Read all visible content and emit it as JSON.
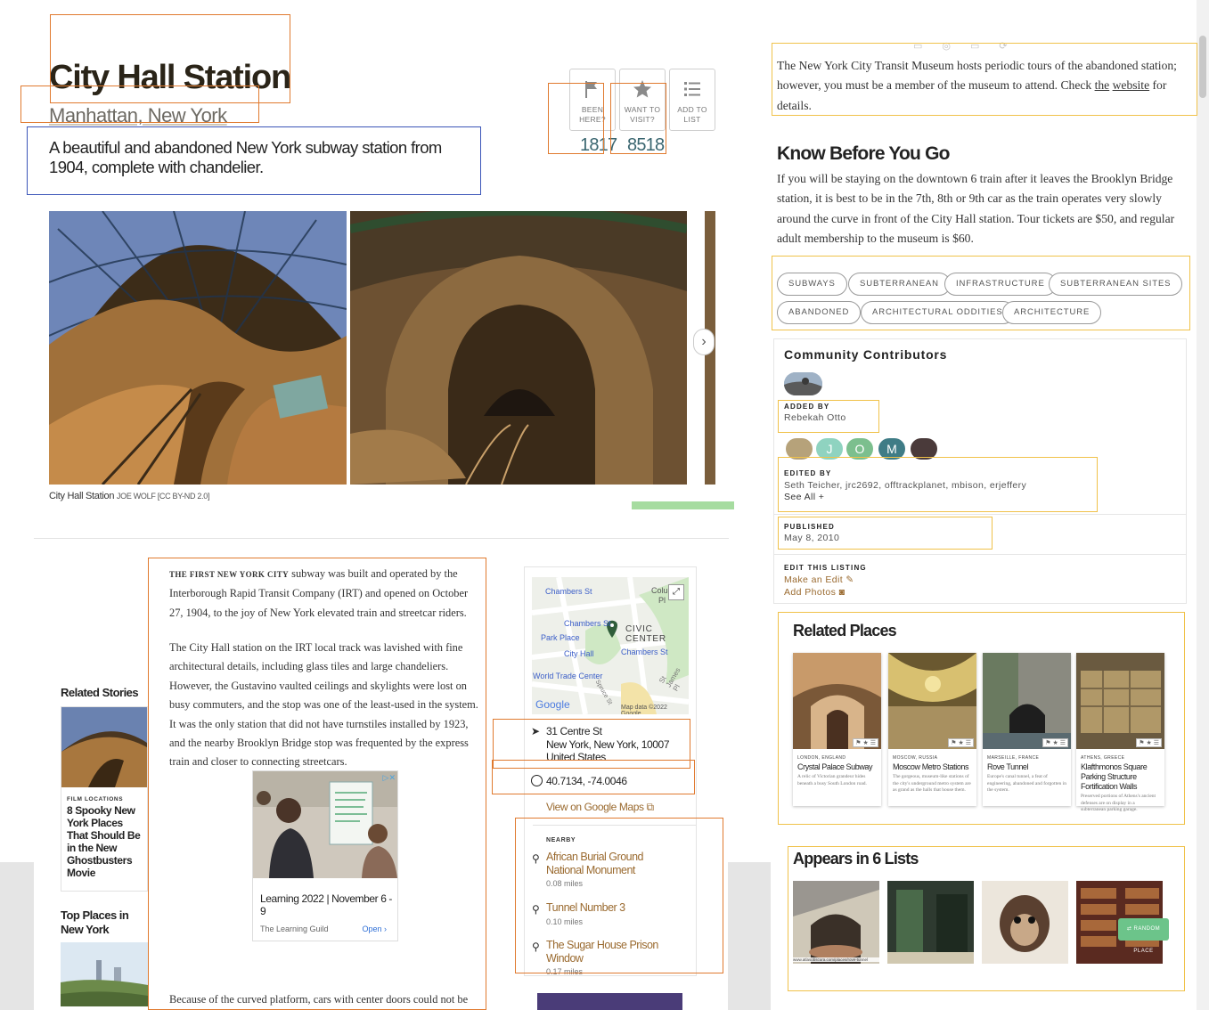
{
  "header": {
    "title": "City Hall Station",
    "location": "Manhattan, New York",
    "subtitle": "A beautiful and abandoned New York subway station from 1904, complete with chandelier."
  },
  "actions": {
    "been_here": {
      "label": "Been here?",
      "count": "1817"
    },
    "want_to_visit": {
      "label": "Want to visit?",
      "count": "8518"
    },
    "add_to_list": {
      "label": "Add to list"
    }
  },
  "gallery": {
    "caption": "City Hall Station",
    "credit": "Joe Wolf [CC BY-ND 2.0]",
    "next_icon": "chevron-right-icon"
  },
  "side_rail": {
    "related_stories_heading": "Related Stories",
    "story": {
      "kicker": "FILM LOCATIONS",
      "title": "8 Spooky New York Places That Should Be in the New Ghostbusters Movie"
    },
    "top_places_heading": "Top Places in New York"
  },
  "article": {
    "lead": "The first New York City",
    "p1": " subway was built and operated by the Interborough Rapid Transit Company (IRT) and opened on October 27, 1904, to the joy of New York elevated train and streetcar riders.",
    "p2": "The City Hall station on the IRT local track was lavished with fine architectural details, including glass tiles and large chandeliers. However, the Gustavino vaulted ceilings and skylights were lost on busy commuters, and the stop was one of the least-used in the system. It was the only station that did not have turnstiles installed by 1923, and the nearby Brooklyn Bridge stop was frequented by the express train and closer to connecting streetcars.",
    "p3": "Because of the curved platform, cars with center doors could not be used at this"
  },
  "ad": {
    "title": "Learning 2022 | November 6 - 9",
    "sponsor": "The Learning Guild",
    "cta": "Open"
  },
  "map": {
    "labels": {
      "chambers_st_1": "Chambers St",
      "chambers_st_2": "Chambers St",
      "chambers_st_3": "Chambers St",
      "park_place": "Park Place",
      "city_hall": "City Hall",
      "wtc": "World Trade Center",
      "civic_center": "CIVIC CENTER",
      "columbus": "Colu",
      "columbus2": "Pl",
      "st_james": "St James Pl",
      "spruce": "Spruce St",
      "brand": "Google",
      "data": "Map data ©2022 Google"
    },
    "address": {
      "line1": "31 Centre St",
      "line2": "New York, New York, 10007",
      "line3": "United States"
    },
    "coordinates": "40.7134, -74.0046",
    "google_link": "View on Google Maps",
    "nearby_kicker": "NEARBY",
    "nearby": [
      {
        "name": "African Burial Ground National Monument",
        "distance": "0.08 miles"
      },
      {
        "name": "Tunnel Number 3",
        "distance": "0.10 miles"
      },
      {
        "name": "The Sugar House Prison Window",
        "distance": "0.17 miles"
      }
    ]
  },
  "right": {
    "tour_text_1": "The New York City Transit Museum hosts periodic tours of the abandoned station; however, you must be a member of the museum to attend. Check ",
    "tour_link_the": "the",
    "tour_link_website": "website",
    "tour_text_2": " for details.",
    "know_before_heading": "Know Before You Go",
    "know_before_text": "If you will be staying on the downtown 6 train after it leaves the Brooklyn Bridge station, it is best to be in the 7th, 8th or 9th car as the train operates very slowly around the curve in front of the City Hall station. Tour tickets are $50, and regular adult membership to the museum is $60.",
    "tags": [
      "Subways",
      "Subterranean",
      "Infrastructure",
      "Subterranean Sites",
      "Abandoned",
      "Architectural Oddities",
      "Architecture"
    ]
  },
  "contributors": {
    "heading": "Community Contributors",
    "added_by_label": "ADDED BY",
    "added_by": "Rebekah Otto",
    "avatars": [
      "J",
      "O",
      "M"
    ],
    "edited_by_label": "EDITED BY",
    "edited_by": "Seth Teicher, jrc2692, offtrackplanet, mbison, erjeffery",
    "see_all": "See All +",
    "published_label": "PUBLISHED",
    "published": "May 8, 2010",
    "edit_label": "EDIT THIS LISTING",
    "make_edit": "Make an Edit",
    "add_photos": "Add Photos"
  },
  "related_places": {
    "heading": "Related Places",
    "items": [
      {
        "kicker": "London, England",
        "title": "Crystal Palace Subway",
        "desc": "A relic of Victorian grandeur hides beneath a busy South London road."
      },
      {
        "kicker": "Moscow, Russia",
        "title": "Moscow Metro Stations",
        "desc": "The gorgeous, museum-like stations of the city's underground metro system are as grand as the halls that house them."
      },
      {
        "kicker": "Marseille, France",
        "title": "Rove Tunnel",
        "desc": "Europe's canal tunnel, a feat of engineering, abandoned and forgotten in the system."
      },
      {
        "kicker": "Athens, Greece",
        "title": "Klafthmonos Square Parking Structure Fortification Walls",
        "desc": "Preserved portions of Athens's ancient defenses are on display in a subterranean parking garage."
      }
    ],
    "icons": "⚑ ★ ☰"
  },
  "lists": {
    "heading": "Appears in 6 Lists",
    "url_overlay": "www.atlasobscura.com/places/rove-tunnel",
    "random_place": "RANDOM PLACE"
  },
  "colors": {
    "accent_brown": "#9a6a2f",
    "count_teal": "#3a6670",
    "annot_orange": "#e07a2f",
    "annot_yellow": "#f0c24a",
    "annot_blue": "#3b55b8"
  }
}
